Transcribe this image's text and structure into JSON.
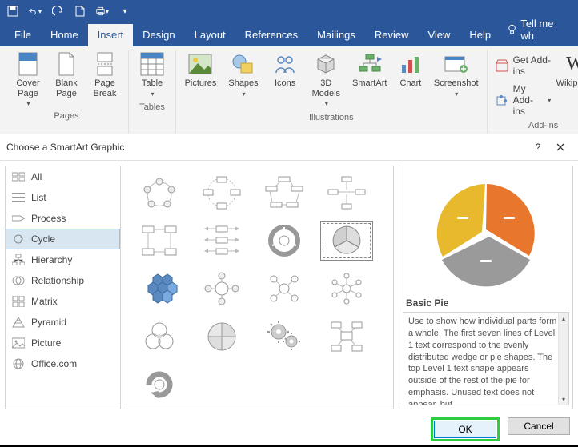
{
  "qat": {
    "icons": [
      "save",
      "undo",
      "redo",
      "new-doc",
      "print",
      "more"
    ]
  },
  "tabs": {
    "items": [
      "File",
      "Home",
      "Insert",
      "Design",
      "Layout",
      "References",
      "Mailings",
      "Review",
      "View",
      "Help"
    ],
    "active": "Insert",
    "tell_me": "Tell me wh"
  },
  "ribbon": {
    "pages": {
      "caption": "Pages",
      "cover": "Cover\nPage",
      "blank": "Blank\nPage",
      "break": "Page\nBreak"
    },
    "tables": {
      "caption": "Tables",
      "table": "Table"
    },
    "illus": {
      "caption": "Illustrations",
      "pictures": "Pictures",
      "shapes": "Shapes",
      "icons": "Icons",
      "models": "3D\nModels",
      "smartart": "SmartArt",
      "chart": "Chart",
      "screenshot": "Screenshot"
    },
    "addins": {
      "caption": "Add-ins",
      "get": "Get Add-ins",
      "my": "My Add-ins",
      "wiki": "Wikipedia"
    }
  },
  "dialog": {
    "title": "Choose a SmartArt Graphic",
    "help": "?",
    "categories": [
      "All",
      "List",
      "Process",
      "Cycle",
      "Hierarchy",
      "Relationship",
      "Matrix",
      "Pyramid",
      "Picture",
      "Office.com"
    ],
    "selected_category": "Cycle",
    "preview_title": "Basic Pie",
    "preview_desc": "Use to show how individual parts form a whole. The first seven lines of Level 1 text correspond to the evenly distributed wedge or pie shapes. The top Level 1 text shape appears outside of the rest of the pie for emphasis. Unused text does not appear, but",
    "ok": "OK",
    "cancel": "Cancel"
  }
}
